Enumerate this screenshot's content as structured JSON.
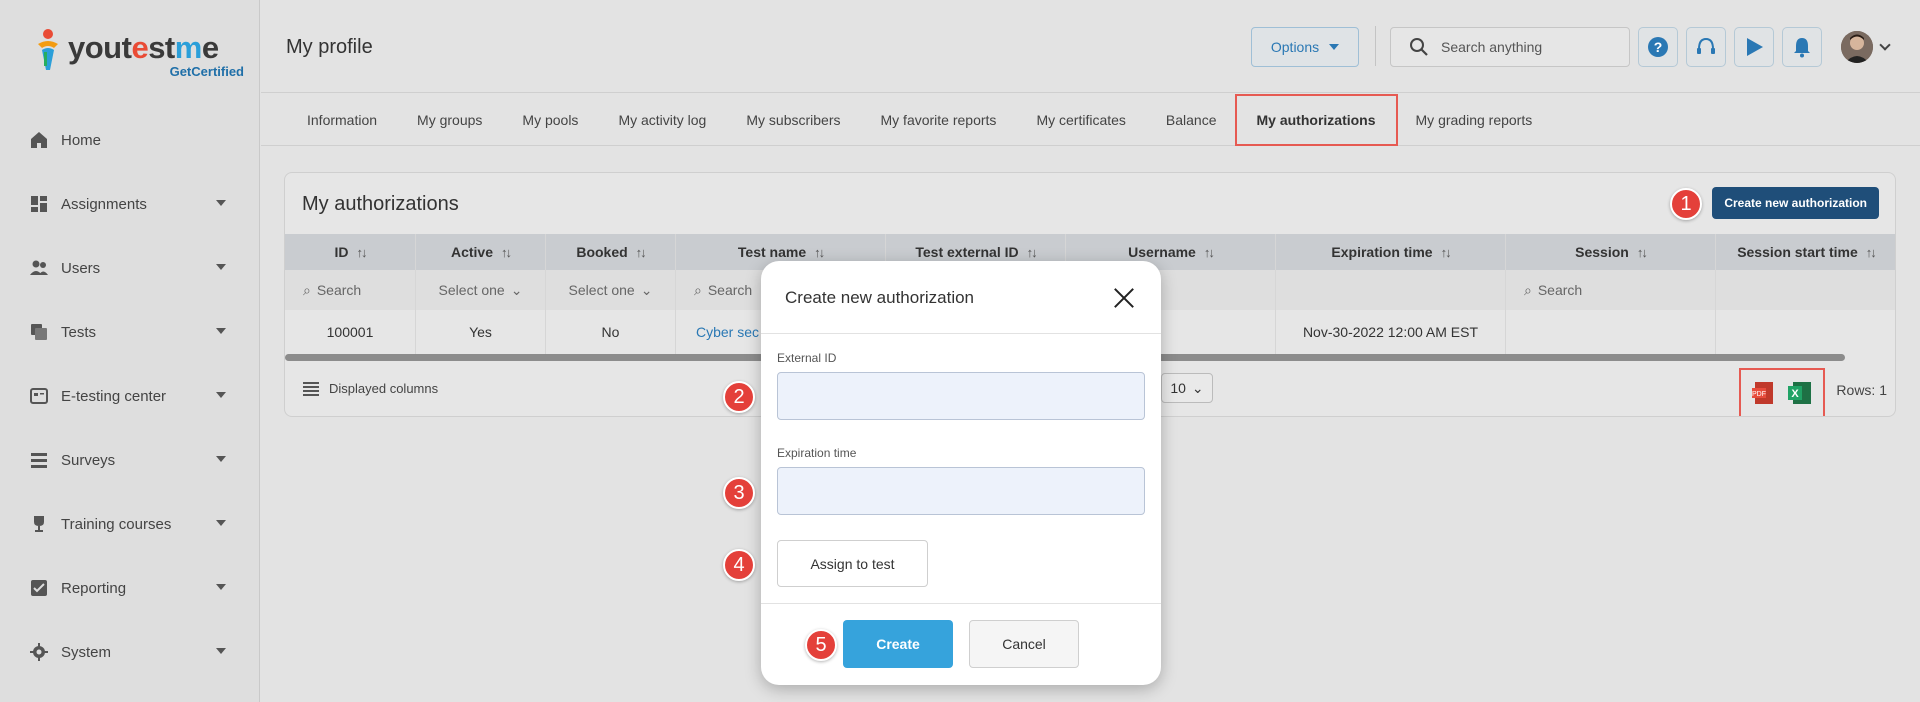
{
  "brand": {
    "logo_text_a": "yout",
    "logo_text_b": "e",
    "logo_text_c": "st",
    "logo_text_d": "m",
    "logo_text_e": "e",
    "logo_sub": "GetCertified",
    "accent": "#1f4e79",
    "primary": "#36a3dc",
    "highlight": "#e65a52"
  },
  "sidebar": {
    "items": [
      {
        "label": "Home",
        "icon": "home-icon",
        "caret": false
      },
      {
        "label": "Assignments",
        "icon": "assignments-icon",
        "caret": true
      },
      {
        "label": "Users",
        "icon": "users-icon",
        "caret": true
      },
      {
        "label": "Tests",
        "icon": "tests-icon",
        "caret": true
      },
      {
        "label": "E-testing center",
        "icon": "testing-center-icon",
        "caret": true
      },
      {
        "label": "Surveys",
        "icon": "surveys-icon",
        "caret": true
      },
      {
        "label": "Training courses",
        "icon": "trophy-icon",
        "caret": true
      },
      {
        "label": "Reporting",
        "icon": "reporting-icon",
        "caret": true
      },
      {
        "label": "System",
        "icon": "gear-icon",
        "caret": true
      }
    ]
  },
  "header": {
    "title": "My profile",
    "options_label": "Options",
    "search_placeholder": "Search anything"
  },
  "tabs": [
    {
      "label": "Information",
      "active": false
    },
    {
      "label": "My groups",
      "active": false
    },
    {
      "label": "My pools",
      "active": false
    },
    {
      "label": "My activity log",
      "active": false
    },
    {
      "label": "My subscribers",
      "active": false
    },
    {
      "label": "My favorite reports",
      "active": false
    },
    {
      "label": "My certificates",
      "active": false
    },
    {
      "label": "Balance",
      "active": false
    },
    {
      "label": "My authorizations",
      "active": true
    },
    {
      "label": "My grading reports",
      "active": false
    }
  ],
  "card": {
    "title": "My authorizations",
    "create_label": "Create new authorization",
    "columns": [
      "ID",
      "Active",
      "Booked",
      "Test name",
      "Test external ID",
      "Username",
      "Expiration time",
      "Session",
      "Session start time"
    ],
    "filters": {
      "search": "Search",
      "select_one": "Select one"
    },
    "row": {
      "id": "100001",
      "active": "Yes",
      "booked": "No",
      "test_name": "Cyber sec",
      "expiration": "Nov-30-2022 12:00 AM EST"
    },
    "displayed_columns": "Displayed columns",
    "page_size": "10",
    "rows_label": "Rows: 1"
  },
  "modal": {
    "title": "Create new authorization",
    "external_id_label": "External ID",
    "expiration_label": "Expiration time",
    "assign_label": "Assign to test",
    "create_label": "Create",
    "cancel_label": "Cancel"
  },
  "badges": [
    "1",
    "2",
    "3",
    "4",
    "5"
  ]
}
